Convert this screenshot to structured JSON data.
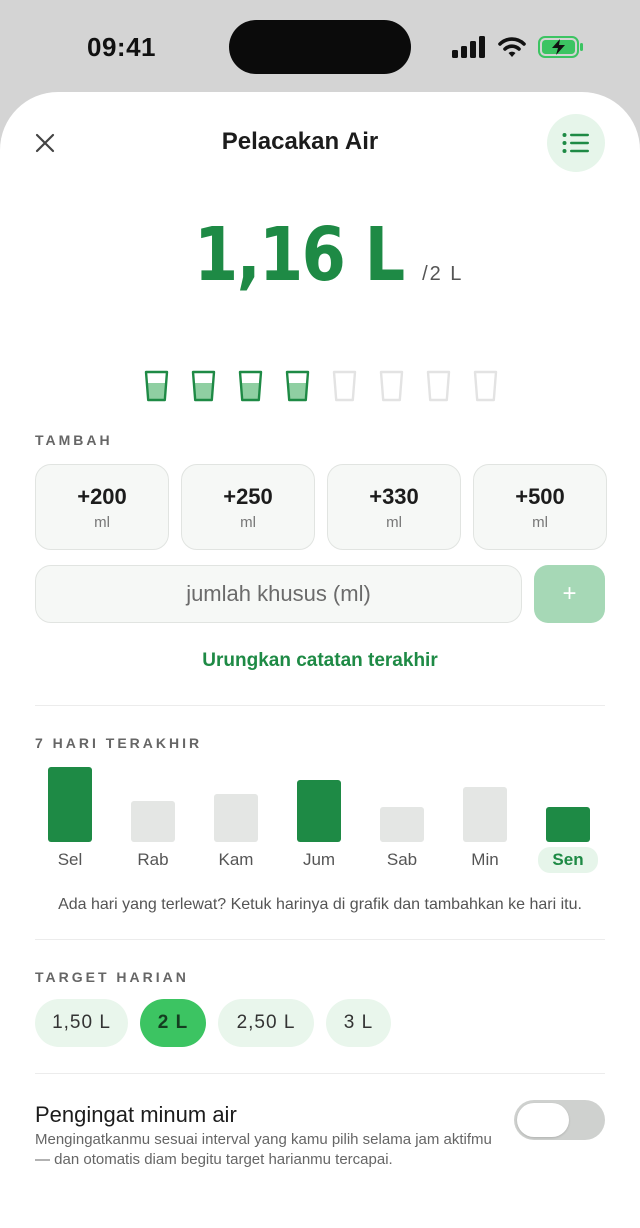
{
  "status_bar": {
    "time": "09:41"
  },
  "header": {
    "title": "Pelacakan Air"
  },
  "intake": {
    "total": "1,16 L",
    "goal": "/2 L",
    "glasses_filled": 4,
    "glasses_total": 8
  },
  "add_section": {
    "label": "TAMBAH",
    "quick_amounts": [
      {
        "amount": "+200",
        "unit": "ml"
      },
      {
        "amount": "+250",
        "unit": "ml"
      },
      {
        "amount": "+330",
        "unit": "ml"
      },
      {
        "amount": "+500",
        "unit": "ml"
      }
    ],
    "custom_placeholder": "jumlah khusus (ml)",
    "add_button_label": "+",
    "undo_label": "Urungkan catatan terakhir"
  },
  "history": {
    "label": "7 HARI TERAKHIR",
    "days": [
      {
        "label": "Sel",
        "level": 1.0,
        "met_goal": true,
        "today": false
      },
      {
        "label": "Rab",
        "level": 0.54,
        "met_goal": false,
        "today": false
      },
      {
        "label": "Kam",
        "level": 0.64,
        "met_goal": false,
        "today": false
      },
      {
        "label": "Jum",
        "level": 0.83,
        "met_goal": true,
        "today": false
      },
      {
        "label": "Sab",
        "level": 0.46,
        "met_goal": false,
        "today": false
      },
      {
        "label": "Min",
        "level": 0.73,
        "met_goal": false,
        "today": false
      },
      {
        "label": "Sen",
        "level": 0.46,
        "met_goal": true,
        "today": true
      }
    ],
    "hint": "Ada hari yang terlewat? Ketuk harinya di grafik dan tambahkan ke hari itu."
  },
  "target": {
    "label": "TARGET HARIAN",
    "options": [
      "1,50 L",
      "2 L",
      "2,50 L",
      "3 L"
    ],
    "selected": "2 L"
  },
  "reminder": {
    "title": "Pengingat minum air",
    "description": "Mengingatkanmu sesuai interval yang kamu pilih selama jam aktifmu — dan otomatis diam begitu target harianmu tercapai.",
    "enabled": false
  },
  "colors": {
    "accent": "#1e8a45",
    "accent_bright": "#3cc462",
    "accent_soft": "#e6f5ea",
    "bar_inactive": "#e4e6e4"
  }
}
